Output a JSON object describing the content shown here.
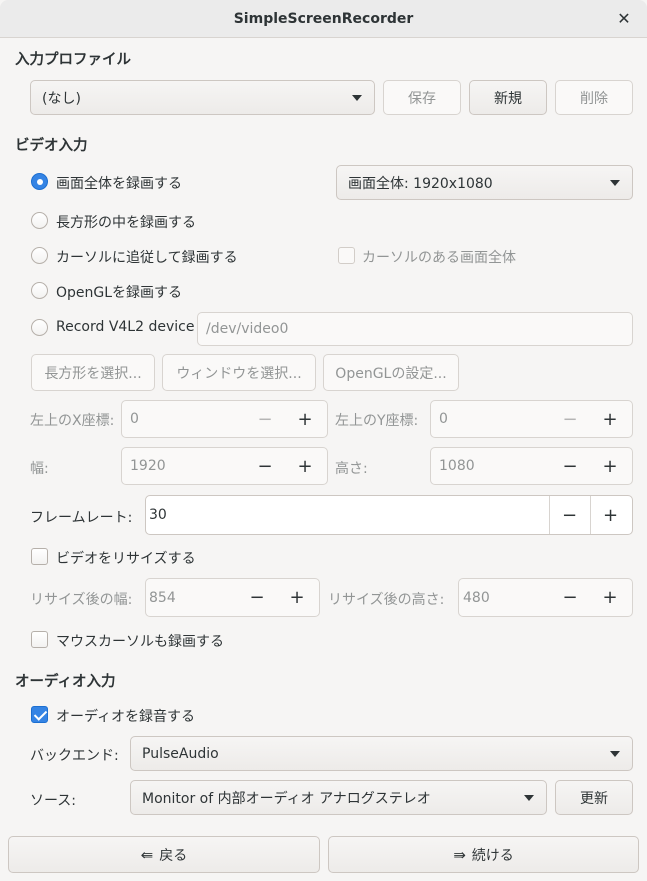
{
  "window": {
    "title": "SimpleScreenRecorder"
  },
  "input_profile": {
    "heading": "入力プロファイル",
    "selected": "(なし)",
    "save_label": "保存",
    "new_label": "新規",
    "delete_label": "削除"
  },
  "video": {
    "heading": "ビデオ入力",
    "mode_fullscreen": "画面全体を録画する",
    "mode_rect": "長方形の中を録画する",
    "mode_follow": "カーソルに追従して録画する",
    "mode_opengl": "OpenGLを録画する",
    "mode_v4l2": "Record V4L2 device",
    "screen_select": "画面全体: 1920x1080",
    "follow_fullscreen": "カーソルのある画面全体",
    "v4l2_device": "/dev/video0",
    "select_rect_label": "長方形を選択...",
    "select_window_label": "ウィンドウを選択...",
    "opengl_settings_label": "OpenGLの設定...",
    "x_label": "左上のX座標:",
    "x_value": "0",
    "y_label": "左上のY座標:",
    "y_value": "0",
    "width_label": "幅:",
    "width_value": "1920",
    "height_label": "高さ:",
    "height_value": "1080",
    "framerate_label": "フレームレート:",
    "framerate_value": "30",
    "resize_label": "ビデオをリサイズする",
    "resize_width_label": "リサイズ後の幅:",
    "resize_width_value": "854",
    "resize_height_label": "リサイズ後の高さ:",
    "resize_height_value": "480",
    "record_cursor_label": "マウスカーソルも録画する",
    "minus": "−",
    "plus": "+"
  },
  "audio": {
    "heading": "オーディオ入力",
    "record_audio_label": "オーディオを録音する",
    "backend_label": "バックエンド:",
    "backend_value": "PulseAudio",
    "source_label": "ソース:",
    "source_value": "Monitor of 内部オーディオ アナログステレオ",
    "refresh_label": "更新"
  },
  "footer": {
    "back_label": "戻る",
    "continue_label": "続ける"
  },
  "colors": {
    "accent": "#3584e4",
    "window_bg": "#f6f5f4",
    "titlebar_bg": "#ebebeb"
  }
}
